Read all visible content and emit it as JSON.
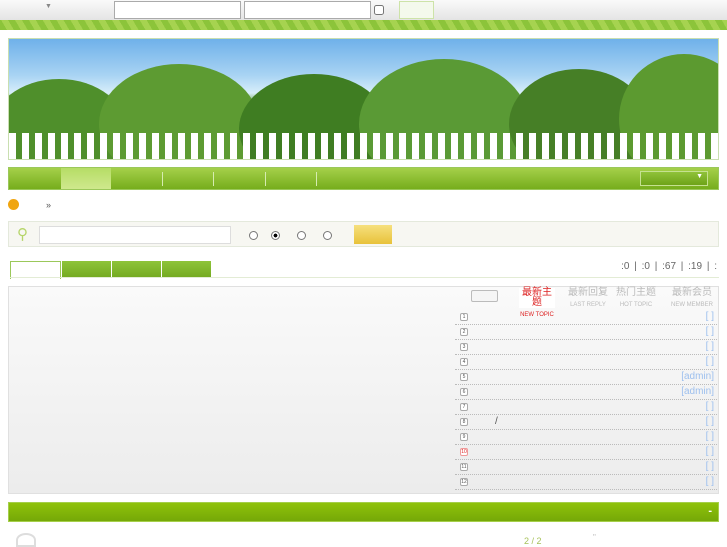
{
  "stats": {
    "text": ":0 | :0 | :67 | :19 |  :"
  },
  "latest_tabs": [
    {
      "zh": "最新主题",
      "en": "NEW TOPIC",
      "active": true
    },
    {
      "zh": "最新回复",
      "en": "LAST REPLY"
    },
    {
      "zh": "热门主题",
      "en": "HOT TOPIC"
    },
    {
      "zh": "最新会员",
      "en": "NEW MEMBER"
    }
  ],
  "topics": [
    {
      "num": "1",
      "author": "[ ]"
    },
    {
      "num": "2",
      "author": "[ ]"
    },
    {
      "num": "3",
      "author": "[ ]"
    },
    {
      "num": "4",
      "author": "[ ]"
    },
    {
      "num": "5",
      "author": "[admin]"
    },
    {
      "num": "6",
      "author": "[admin]"
    },
    {
      "num": "7",
      "author": "[ ]"
    },
    {
      "num": "8",
      "author": "[ ]",
      "title": "/"
    },
    {
      "num": "9",
      "author": "[ ]"
    },
    {
      "num": "10",
      "author": "[ ]"
    },
    {
      "num": "11",
      "author": "[ ]"
    },
    {
      "num": "12",
      "author": "[ ]"
    }
  ],
  "notice": {
    "text": "»"
  },
  "footer": {
    "toggle": "-",
    "pages": "2 / 2",
    "quote": "\""
  },
  "colors": {
    "accent": "#8cc43a",
    "red": "#d22",
    "link": "#9ec0ee"
  }
}
